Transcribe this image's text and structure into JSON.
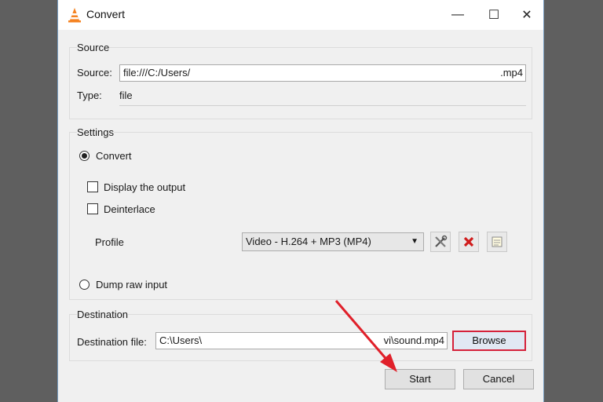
{
  "window": {
    "title": "Convert",
    "minimize": "—",
    "maximize": "☐",
    "close": "✕"
  },
  "source": {
    "group_label": "Source",
    "source_label": "Source:",
    "source_value_start": "file:///C:/Users/",
    "source_value_end": ".mp4",
    "type_label": "Type:",
    "type_value": "file"
  },
  "settings": {
    "group_label": "Settings",
    "convert_label": "Convert",
    "display_output_label": "Display the output",
    "deinterlace_label": "Deinterlace",
    "profile_label": "Profile",
    "profile_value": "Video - H.264 + MP3 (MP4)",
    "dump_raw_label": "Dump raw input"
  },
  "destination": {
    "group_label": "Destination",
    "file_label": "Destination file:",
    "file_value_start": "C:\\Users\\",
    "file_value_end": "vi\\sound.mp4",
    "browse_label": "Browse"
  },
  "actions": {
    "start_label": "Start",
    "cancel_label": "Cancel"
  },
  "colors": {
    "highlight": "#d5213a",
    "arrow": "#e0202a"
  }
}
